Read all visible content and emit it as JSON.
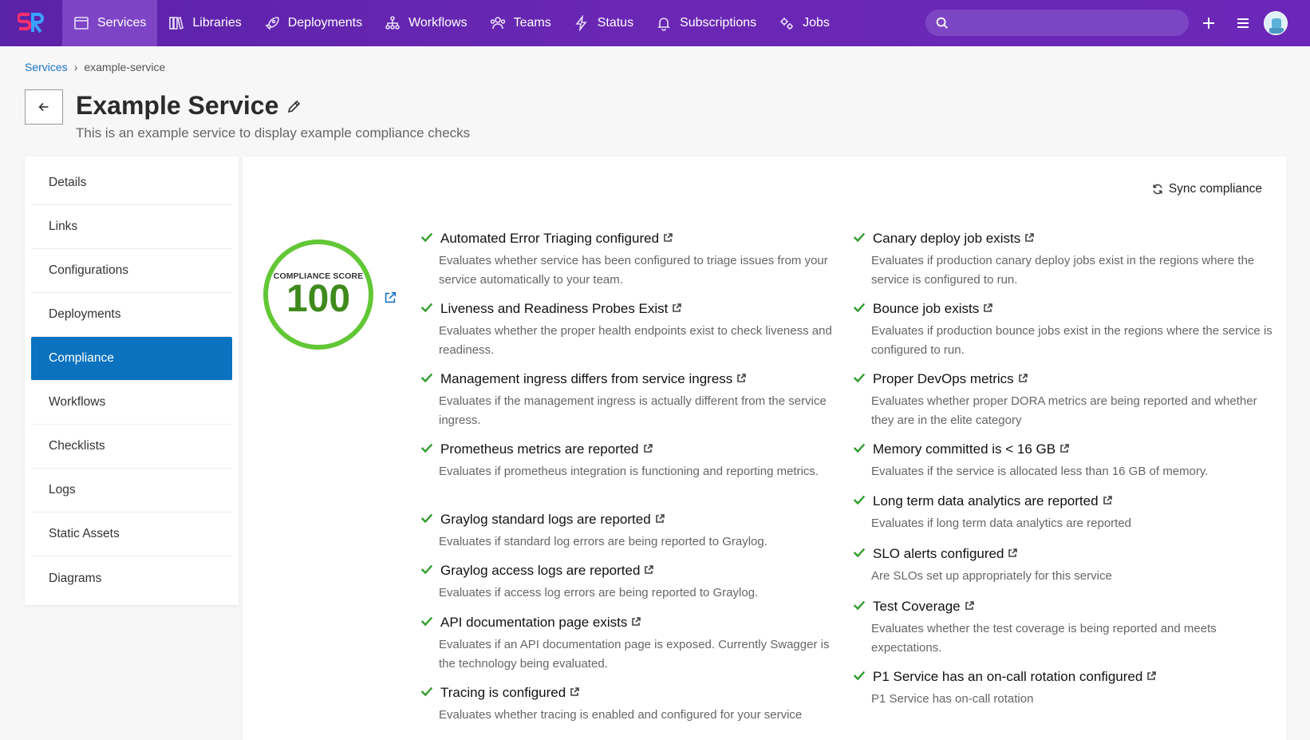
{
  "nav": {
    "items": [
      {
        "label": "Services",
        "icon": "calendar-icon"
      },
      {
        "label": "Libraries",
        "icon": "books-icon"
      },
      {
        "label": "Deployments",
        "icon": "rocket-icon"
      },
      {
        "label": "Workflows",
        "icon": "hierarchy-icon"
      },
      {
        "label": "Teams",
        "icon": "people-icon"
      },
      {
        "label": "Status",
        "icon": "lightning-icon"
      },
      {
        "label": "Subscriptions",
        "icon": "bell-icon"
      },
      {
        "label": "Jobs",
        "icon": "gears-icon"
      }
    ],
    "active": "Services",
    "search_placeholder": "",
    "accent": "#6a27b4"
  },
  "breadcrumb": {
    "root": "Services",
    "separator": "›",
    "current": "example-service"
  },
  "header": {
    "title": "Example Service",
    "subtitle": "This is an example service to display example compliance checks"
  },
  "sidenav": {
    "items": [
      "Details",
      "Links",
      "Configurations",
      "Deployments",
      "Compliance",
      "Workflows",
      "Checklists",
      "Logs",
      "Static Assets",
      "Diagrams"
    ],
    "active": "Compliance"
  },
  "compliance": {
    "sync_label": "Sync compliance",
    "score_label": "COMPLIANCE SCORE",
    "score": "100",
    "left_checks": [
      {
        "title": "Automated Error Triaging configured",
        "desc": "Evaluates whether service has been configured to triage issues from your service automatically to your team."
      },
      {
        "title": "Liveness and Readiness Probes Exist",
        "desc": "Evaluates whether the proper health endpoints exist to check liveness and readiness."
      },
      {
        "title": "Management ingress differs from service ingress",
        "desc": "Evaluates if the management ingress is actually different from the service ingress."
      },
      {
        "title": "Prometheus metrics are reported",
        "desc": "Evaluates if prometheus integration is functioning and reporting metrics."
      },
      {
        "title": "Graylog standard logs are reported",
        "desc": "Evaluates if standard log errors are being reported to Graylog."
      },
      {
        "title": "Graylog access logs are reported",
        "desc": "Evaluates if access log errors are being reported to Graylog."
      },
      {
        "title": "API documentation page exists",
        "desc": "Evaluates if an API documentation page is exposed. Currently Swagger is the technology being evaluated."
      },
      {
        "title": "Tracing is configured",
        "desc": "Evaluates whether tracing is enabled and configured for your service"
      }
    ],
    "right_checks": [
      {
        "title": "Canary deploy job exists",
        "desc": "Evaluates if production canary deploy jobs exist in the regions where the service is configured to run."
      },
      {
        "title": "Bounce job exists",
        "desc": "Evaluates if production bounce jobs exist in the regions where the service is configured to run."
      },
      {
        "title": "Proper DevOps metrics",
        "desc": "Evaluates whether proper DORA metrics are being reported and whether they are in the elite category"
      },
      {
        "title": "Memory committed is < 16 GB",
        "desc": "Evaluates if the service is allocated less than 16 GB of memory."
      },
      {
        "title": "Long term data analytics are reported",
        "desc": "Evaluates if long term data analytics are reported"
      },
      {
        "title": "SLO alerts configured",
        "desc": "Are SLOs set up appropriately for this service"
      },
      {
        "title": "Test Coverage",
        "desc": "Evaluates whether the test coverage is being reported and meets expectations."
      },
      {
        "title": "P1 Service has an on-call rotation configured",
        "desc": "P1 Service has on-call rotation"
      }
    ]
  }
}
